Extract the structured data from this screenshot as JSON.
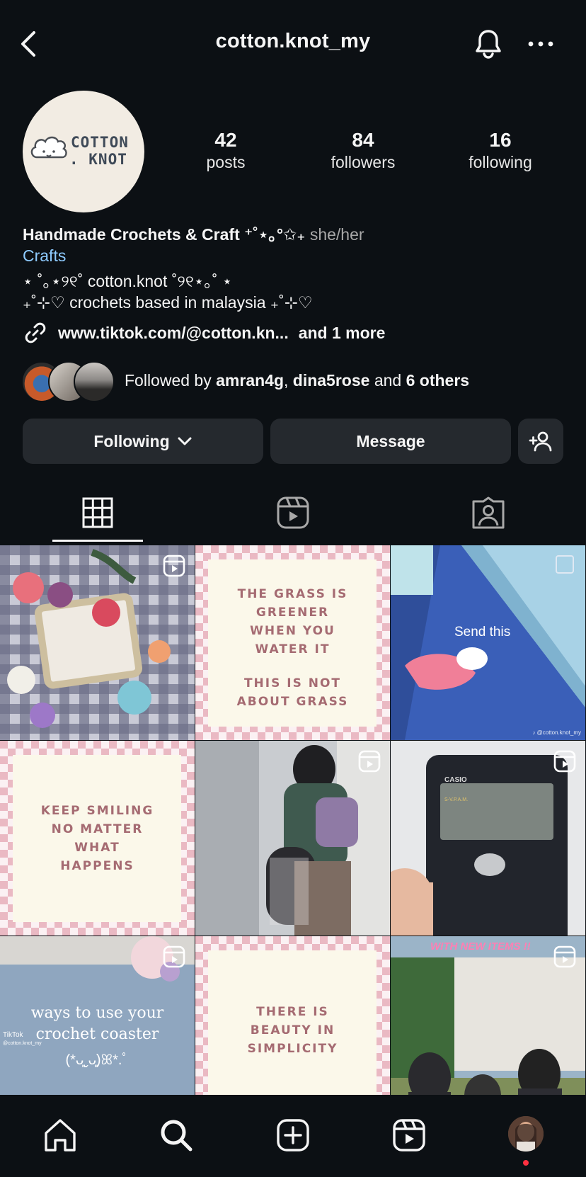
{
  "header": {
    "username": "cotton.knot_my"
  },
  "profile": {
    "avatar_text_line1": "COTTON",
    "avatar_text_line2": ". KNOT",
    "stats": [
      {
        "value": "42",
        "label": "posts"
      },
      {
        "value": "84",
        "label": "followers"
      },
      {
        "value": "16",
        "label": "following"
      }
    ]
  },
  "bio": {
    "name": "Handmade Crochets & Craft ⁺˚⋆｡°✩₊",
    "pronouns": "she/her",
    "category": "Crafts",
    "line1": "⋆ ˚｡⋆୨୧˚ cotton.knot ˚୨୧⋆｡˚ ⋆",
    "line2": "₊˚⊹♡ crochets based in malaysia ₊˚⊹♡",
    "link": "www.tiktok.com/@cotton.kn...",
    "link_more": "and 1 more"
  },
  "followed_by": {
    "prefix": "Followed by",
    "user1": "amran4g",
    "sep": ",",
    "user2": "dina5rose",
    "and": "and",
    "others": "6 others"
  },
  "buttons": {
    "following": "Following",
    "message": "Message"
  },
  "grid": {
    "post2_text": [
      "THE GRASS IS",
      "GREENER",
      "WHEN YOU",
      "WATER IT",
      "",
      "THIS IS NOT",
      "ABOUT GRASS"
    ],
    "post3_text": "Send this",
    "post3_watermark": "♪ @cotton.knot_my",
    "post4_text": [
      "KEEP SMILING",
      "NO MATTER",
      "WHAT",
      "HAPPENS"
    ],
    "post6_brand": "CASIO",
    "post6_model": "S-V.P.A.M.",
    "post7_line1": "ways to use your",
    "post7_line2": "crochet coaster",
    "post7_line3": "(*ᴗ͈ˬᴗ͈)ꕤ*.ﾟ",
    "post7_tiktok": "TikTok",
    "post7_handle": "@cotton.knot_my",
    "post8_text": [
      "THERE IS",
      "BEAUTY IN",
      "SIMPLICITY"
    ],
    "post9_banner": "WITH NEW ITEMS !!"
  },
  "colors": {
    "background": "#0c1014",
    "button": "#25292e",
    "link": "#8ecbff",
    "notification_dot": "#ff3040"
  }
}
